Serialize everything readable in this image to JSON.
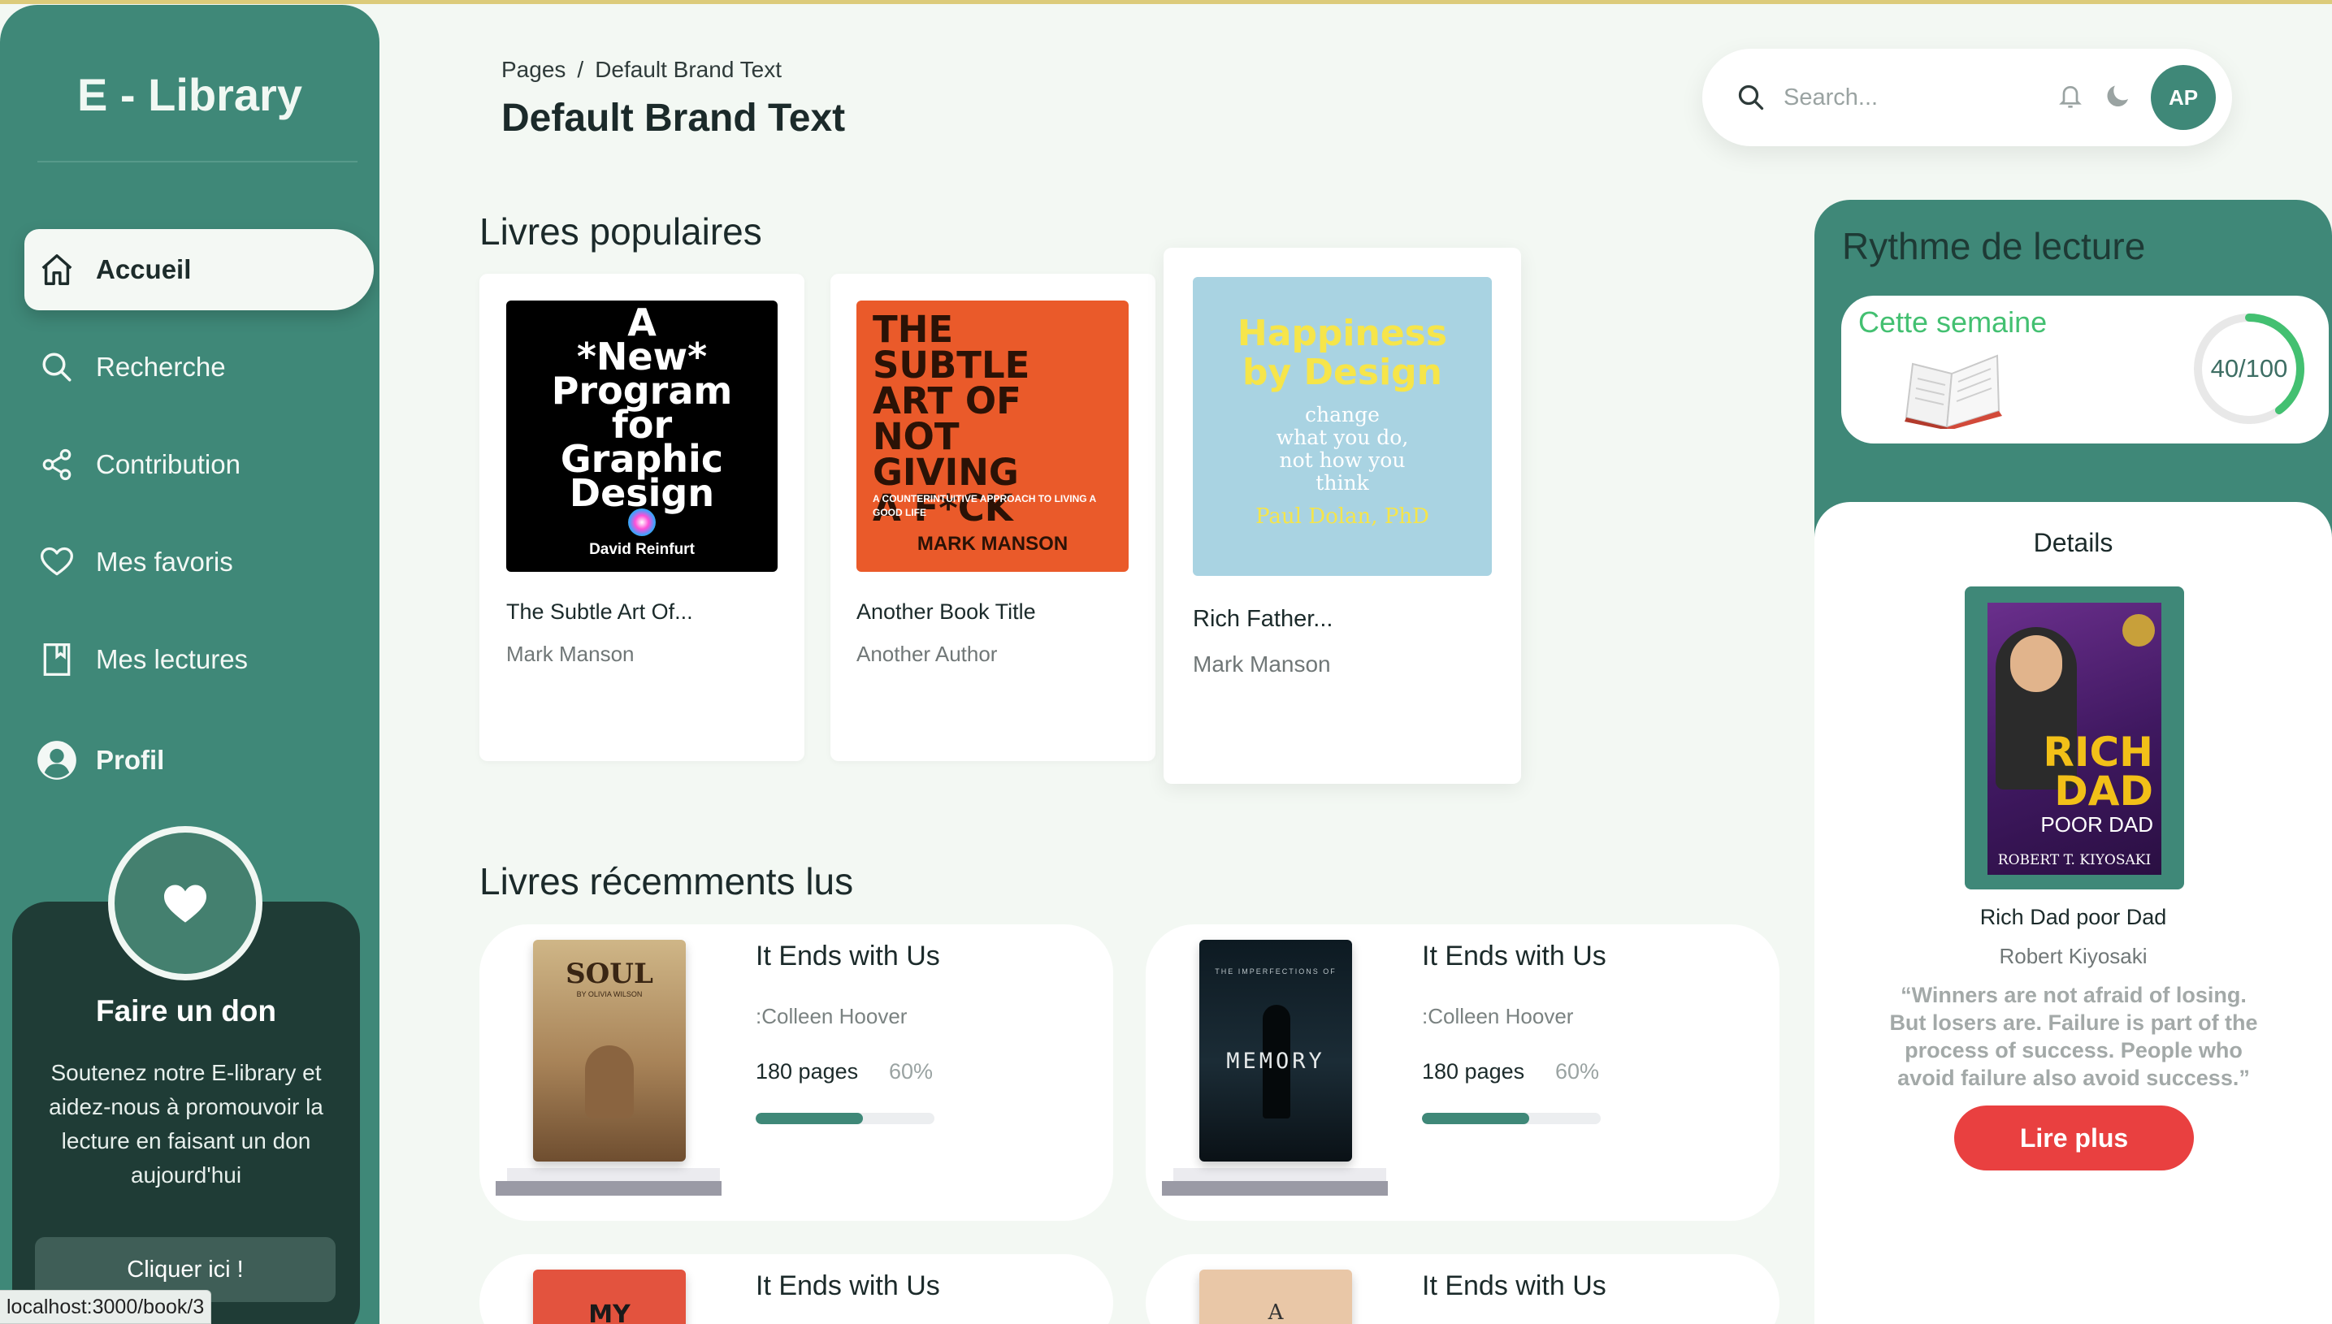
{
  "brand": {
    "name": "E - Library"
  },
  "nav": {
    "items": [
      {
        "label": "Accueil",
        "icon": "home-icon"
      },
      {
        "label": "Recherche",
        "icon": "search-icon"
      },
      {
        "label": "Contribution",
        "icon": "share-icon"
      },
      {
        "label": "Mes favoris",
        "icon": "heart-icon"
      },
      {
        "label": "Mes lectures",
        "icon": "bookmark-icon"
      },
      {
        "label": "Profil",
        "icon": "user-circle-icon"
      }
    ],
    "active_index": 0
  },
  "donate": {
    "title": "Faire un don",
    "text": "Soutenez notre E-library et aidez-nous à promouvoir la lecture en faisant un don aujourd'hui",
    "button": "Cliquer ici !"
  },
  "status_url": "localhost:3000/book/3",
  "header": {
    "breadcrumb_root": "Pages",
    "breadcrumb_sep": "/",
    "breadcrumb_current": "Default Brand Text",
    "title": "Default Brand Text",
    "search_placeholder": "Search...",
    "avatar_initials": "AP"
  },
  "popular": {
    "title": "Livres populaires",
    "books": [
      {
        "title": "The Subtle Art Of...",
        "author": "Mark Manson",
        "cover_text": [
          "A",
          "*New*",
          "Program",
          "for",
          "Graphic",
          "Design"
        ],
        "cover_author": "David Reinfurt"
      },
      {
        "title": "Another Book Title",
        "author": "Another Author",
        "cover_text": [
          "THE",
          "SUBTLE",
          "ART OF",
          "NOT",
          "GIVING",
          "A F*CK"
        ],
        "cover_sub": "A COUNTERINTUITIVE APPROACH TO LIVING A GOOD LIFE",
        "cover_author": "MARK MANSON"
      },
      {
        "title": "Rich Father...",
        "author": "Mark Manson",
        "cover_text": [
          "Happiness",
          "by Design"
        ],
        "cover_sub": [
          "change",
          "what you do,",
          "not how you",
          "think"
        ],
        "cover_author": "Paul Dolan, PhD"
      }
    ]
  },
  "recent": {
    "title": "Livres récemments lus",
    "items": [
      {
        "title": "It Ends with Us",
        "author": ":Colleen Hoover",
        "pages": "180 pages",
        "percent": "60%",
        "progress": 0.6,
        "cover_word": "SOUL",
        "cover_sub": "BY OLIVIA WILSON"
      },
      {
        "title": "It Ends with Us",
        "author": ":Colleen Hoover",
        "pages": "180 pages",
        "percent": "60%",
        "progress": 0.6,
        "cover_word": "MEMORY",
        "cover_sub": "THE IMPERFECTIONS OF"
      },
      {
        "title": "It Ends with Us",
        "cover_word": "MY"
      },
      {
        "title": "It Ends with Us",
        "cover_word": "A"
      }
    ]
  },
  "rhythm": {
    "title": "Rythme de lecture",
    "week_label": "Cette semaine",
    "progress_text": "40/100",
    "progress": 0.4,
    "ring_color": "#43c071"
  },
  "details": {
    "title": "Details",
    "book_title": "Rich Dad poor Dad",
    "author": "Robert Kiyosaki",
    "quote": "“Winners are not afraid of losing. But losers are. Failure is part of the process of success. People who avoid failure also avoid success.”",
    "button": "Lire plus",
    "cover_lines": [
      "RICH",
      "DAD",
      "POOR DAD"
    ],
    "cover_author": "ROBERT T. KIYOSAKI"
  },
  "colors": {
    "primary": "#3f8878",
    "accent_red": "#e94040",
    "dark": "#1f3c36"
  }
}
